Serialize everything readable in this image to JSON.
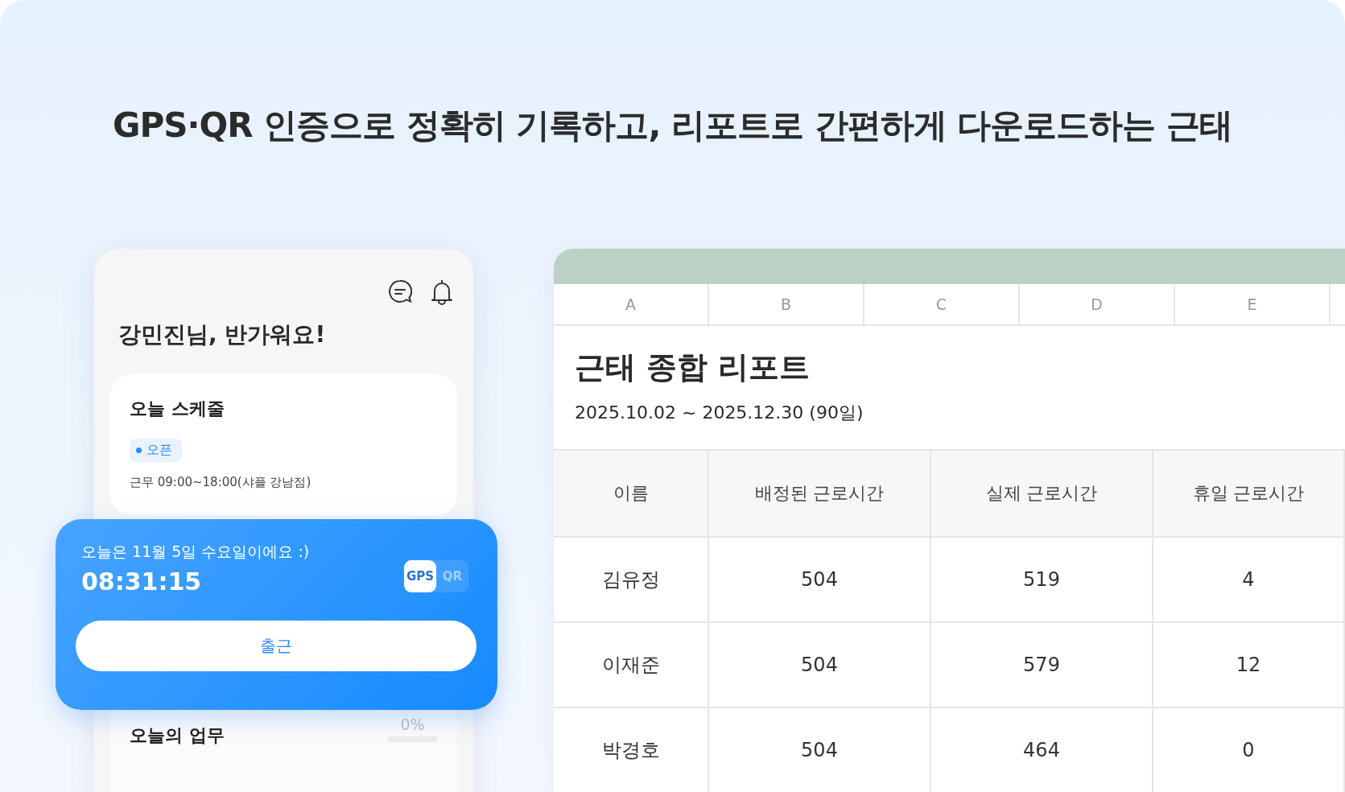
{
  "headline": "GPS·QR 인증으로 정확히 기록하고, 리포트로 간편하게 다운로드하는 근태",
  "app": {
    "greeting": "강민진님, 반가워요!",
    "schedule": {
      "title": "오늘 스케줄",
      "badge": "오픈",
      "shift": "근무 09:00~18:00(샤플 강남점)"
    },
    "checkin": {
      "date_text": "오늘은 11월 5일 수요일이에요 :)",
      "time": "08:31:15",
      "methods": [
        {
          "label": "GPS",
          "selected": true
        },
        {
          "label": "QR",
          "selected": false
        }
      ],
      "button": "출근"
    },
    "tasks": {
      "title": "오늘의 업무",
      "percent": "0%",
      "level": 0
    }
  },
  "sheet": {
    "column_letters": [
      "A",
      "B",
      "C",
      "D",
      "E"
    ],
    "title": "근태 종합 리포트",
    "period": "2025.10.02 ~ 2025.12.30 (90일)",
    "columns": [
      "이름",
      "배정된 근로시간",
      "실제 근로시간",
      "휴일 근로시간"
    ],
    "rows": [
      [
        "김유정",
        "504",
        "519",
        "4"
      ],
      [
        "이재준",
        "504",
        "579",
        "12"
      ],
      [
        "박경호",
        "504",
        "464",
        "0"
      ]
    ]
  }
}
